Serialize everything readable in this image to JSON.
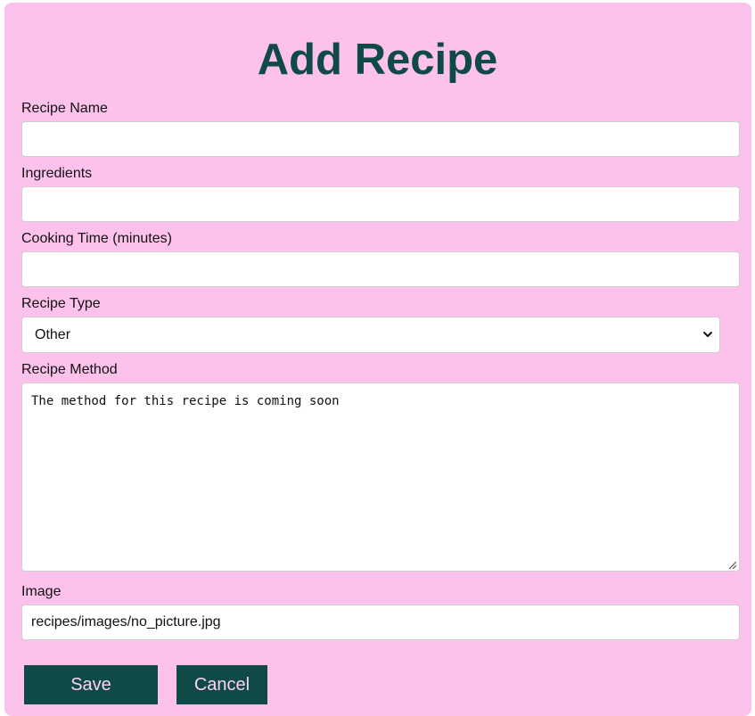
{
  "page": {
    "title": "Add Recipe"
  },
  "form": {
    "recipe_name": {
      "label": "Recipe Name",
      "value": ""
    },
    "ingredients": {
      "label": "Ingredients",
      "value": ""
    },
    "cooking_time": {
      "label": "Cooking Time (minutes)",
      "value": ""
    },
    "recipe_type": {
      "label": "Recipe Type",
      "selected": "Other"
    },
    "recipe_method": {
      "label": "Recipe Method",
      "value": "The method for this recipe is coming soon"
    },
    "image": {
      "label": "Image",
      "value": "recipes/images/no_picture.jpg"
    }
  },
  "actions": {
    "save_label": "Save",
    "cancel_label": "Cancel"
  },
  "colors": {
    "background": "#fcc2ec",
    "accent": "#0f4a47",
    "button_text": "#fcd4ef"
  },
  "icons": {
    "select_arrow": "chevron-down-icon",
    "textarea_resize": "resize-grip-icon"
  }
}
